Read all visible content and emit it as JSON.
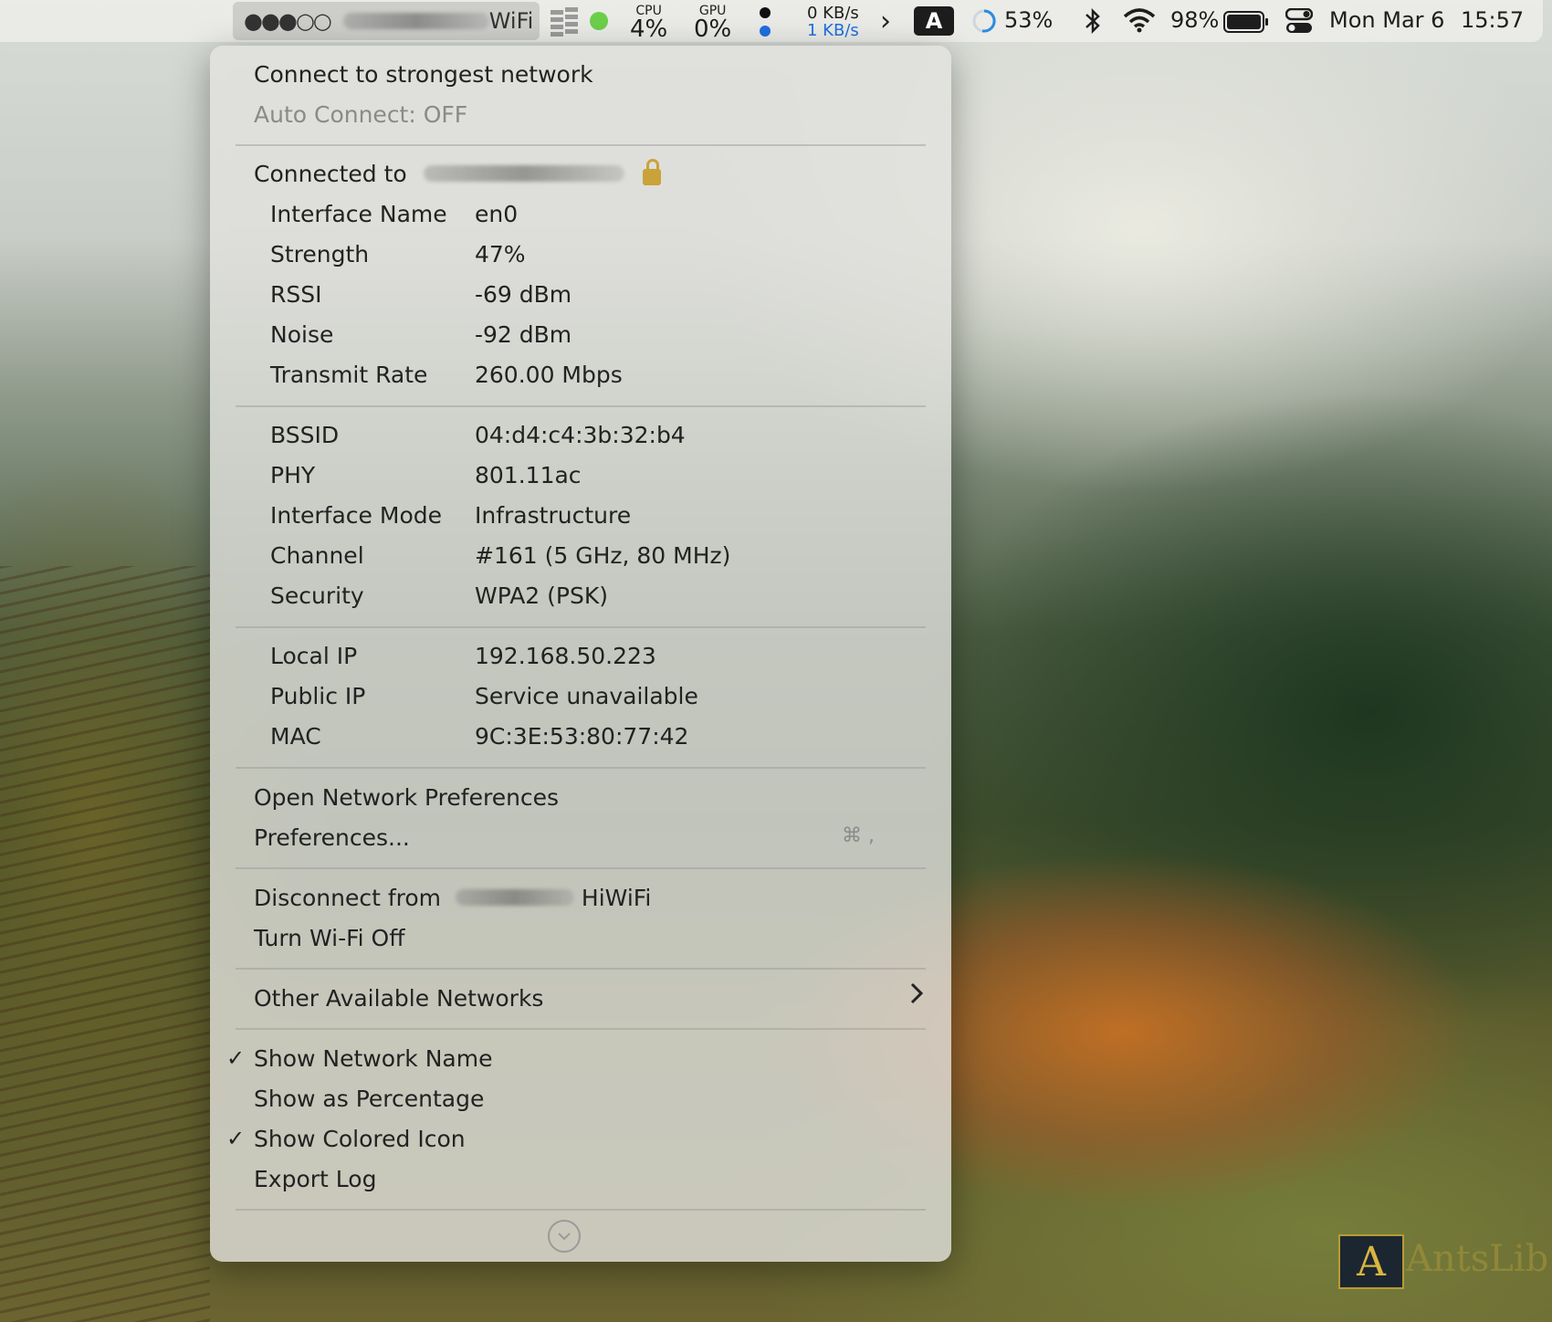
{
  "menubar": {
    "wifi_dots": "●●●○○",
    "wifi_suffix": "WiFi",
    "cpu_label": "CPU",
    "cpu_value": "4%",
    "gpu_label": "GPU",
    "gpu_value": "0%",
    "net_up": "0 KB/s",
    "net_down": "1 KB/s",
    "chevron": "›",
    "input_source": "A",
    "ring_value": "53%",
    "battery_percent": "98%",
    "date": "Mon Mar 6",
    "time": "15:57"
  },
  "menu": {
    "connect_strongest": "Connect to strongest network",
    "auto_connect": "Auto Connect: OFF",
    "connected_to": "Connected to",
    "details": [
      {
        "label": "Interface Name",
        "value": "en0"
      },
      {
        "label": "Strength",
        "value": "47%"
      },
      {
        "label": "RSSI",
        "value": "-69 dBm"
      },
      {
        "label": "Noise",
        "value": "-92 dBm"
      },
      {
        "label": "Transmit Rate",
        "value": "260.00 Mbps"
      }
    ],
    "details2": [
      {
        "label": "BSSID",
        "value": "04:d4:c4:3b:32:b4"
      },
      {
        "label": "PHY",
        "value": "801.11ac"
      },
      {
        "label": "Interface Mode",
        "value": "Infrastructure"
      },
      {
        "label": "Channel",
        "value": "#161 (5 GHz, 80 MHz)"
      },
      {
        "label": "Security",
        "value": "WPA2 (PSK)"
      }
    ],
    "details3": [
      {
        "label": "Local IP",
        "value": "192.168.50.223"
      },
      {
        "label": "Public IP",
        "value": "Service unavailable"
      },
      {
        "label": "MAC",
        "value": "9C:3E:53:80:77:42"
      }
    ],
    "open_network_prefs": "Open Network Preferences",
    "preferences": "Preferences...",
    "preferences_shortcut": "⌘ ,",
    "disconnect_from": "Disconnect from",
    "disconnect_suffix": "HiWiFi",
    "turn_wifi_off": "Turn Wi-Fi Off",
    "other_networks": "Other Available Networks",
    "show_network_name": "Show Network Name",
    "show_as_percentage": "Show as Percentage",
    "show_colored_icon": "Show Colored Icon",
    "export_log": "Export Log",
    "check_mark": "✓"
  },
  "watermark": {
    "letter": "A",
    "text": "AntsLib"
  }
}
